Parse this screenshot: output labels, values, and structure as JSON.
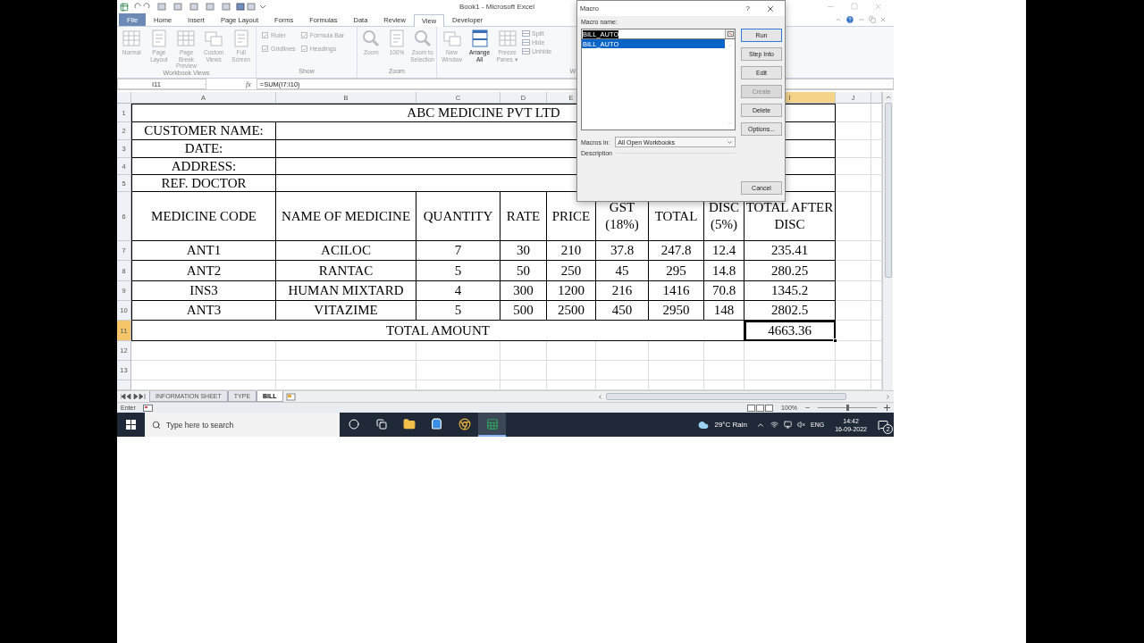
{
  "title_bar": {
    "title": "Book1 - Microsoft Excel"
  },
  "ribbon_tabs": [
    {
      "label": "File",
      "selected": false,
      "kind": "file"
    },
    {
      "label": "Home",
      "selected": false,
      "kind": "tab"
    },
    {
      "label": "Insert",
      "selected": false,
      "kind": "tab"
    },
    {
      "label": "Page Layout",
      "selected": false,
      "kind": "tab"
    },
    {
      "label": "Forms",
      "selected": false,
      "kind": "tab"
    },
    {
      "label": "Formulas",
      "selected": false,
      "kind": "tab"
    },
    {
      "label": "Data",
      "selected": false,
      "kind": "tab"
    },
    {
      "label": "Review",
      "selected": false,
      "kind": "tab"
    },
    {
      "label": "View",
      "selected": true,
      "kind": "tab"
    },
    {
      "label": "Developer",
      "selected": false,
      "kind": "tab"
    }
  ],
  "ribbon_groups": [
    {
      "label": "Workbook Views",
      "items": [
        {
          "kind": "button",
          "label": "Normal",
          "disabled": true
        },
        {
          "kind": "button",
          "label": "Page Layout",
          "disabled": true
        },
        {
          "kind": "button",
          "label": "Page Break Preview",
          "disabled": true
        },
        {
          "kind": "button",
          "label": "Custom Views",
          "disabled": true
        },
        {
          "kind": "button",
          "label": "Full Screen",
          "disabled": true
        }
      ]
    },
    {
      "label": "Show",
      "items": [
        {
          "kind": "checkbox",
          "label": "Ruler",
          "checked": true,
          "disabled": true
        },
        {
          "kind": "checkbox",
          "label": "Gridlines",
          "checked": true,
          "disabled": true
        },
        {
          "kind": "checkbox",
          "label": "Formula Bar",
          "checked": true,
          "disabled": true
        },
        {
          "kind": "checkbox",
          "label": "Headings",
          "checked": true,
          "disabled": true
        }
      ]
    },
    {
      "label": "Zoom",
      "items": [
        {
          "kind": "button",
          "label": "Zoom",
          "disabled": true
        },
        {
          "kind": "button",
          "label": "100%",
          "disabled": true
        },
        {
          "kind": "button",
          "label": "Zoom to Selection",
          "disabled": true
        }
      ]
    },
    {
      "label": "W",
      "items": [
        {
          "kind": "button",
          "label": "New Window",
          "disabled": true
        },
        {
          "kind": "button",
          "label": "Arrange All",
          "disabled": false
        },
        {
          "kind": "button",
          "label": "Freeze Panes ▾",
          "disabled": true
        },
        {
          "kind": "small",
          "label": "Split",
          "disabled": true
        },
        {
          "kind": "small",
          "label": "Hide",
          "disabled": true
        },
        {
          "kind": "small",
          "label": "Unhide",
          "disabled": true
        }
      ]
    }
  ],
  "formula_bar": {
    "name_box": "I11",
    "function_label": "fx",
    "formula": "=SUM(I7:I10)"
  },
  "sheet": {
    "columns": [
      {
        "label": "A",
        "selected": false
      },
      {
        "label": "B",
        "selected": false
      },
      {
        "label": "C",
        "selected": false
      },
      {
        "label": "D",
        "selected": false
      },
      {
        "label": "E",
        "selected": false
      },
      {
        "label": "I",
        "selected": true
      },
      {
        "label": "J",
        "selected": false
      }
    ],
    "rows": [
      {
        "number": "1",
        "selected": false
      },
      {
        "number": "2",
        "selected": false
      },
      {
        "number": "3",
        "selected": false
      },
      {
        "number": "4",
        "selected": false
      },
      {
        "number": "5",
        "selected": false
      },
      {
        "number": "6",
        "selected": false
      },
      {
        "number": "7",
        "selected": false
      },
      {
        "number": "8",
        "selected": false
      },
      {
        "number": "9",
        "selected": false
      },
      {
        "number": "10",
        "selected": false
      },
      {
        "number": "11",
        "selected": true
      },
      {
        "number": "12",
        "selected": false
      },
      {
        "number": "13",
        "selected": false
      }
    ],
    "title": "ABC MEDICINE PVT LTD",
    "info_labels": [
      "CUSTOMER NAME:",
      "DATE:",
      "ADDRESS:",
      "REF. DOCTOR"
    ],
    "headers": [
      "MEDICINE CODE",
      "NAME OF MEDICINE",
      "QUANTITY",
      "RATE",
      "PRICE",
      "GST (18%)",
      "TOTAL",
      "DISC (5%)",
      "TOTAL AFTER DISC"
    ],
    "data": [
      [
        "ANT1",
        "ACILOC",
        "7",
        "30",
        "210",
        "37.8",
        "247.8",
        "12.4",
        "235.41"
      ],
      [
        "ANT2",
        "RANTAC",
        "5",
        "50",
        "250",
        "45",
        "295",
        "14.8",
        "280.25"
      ],
      [
        "INS3",
        "HUMAN MIXTARD",
        "4",
        "300",
        "1200",
        "216",
        "1416",
        "70.8",
        "1345.2"
      ],
      [
        "ANT3",
        "VITAZIME",
        "5",
        "500",
        "2500",
        "450",
        "2950",
        "148",
        "2802.5"
      ]
    ],
    "total": {
      "label": "TOTAL AMOUNT",
      "value": "4663.36",
      "selected": true
    }
  },
  "sheet_tabs": [
    {
      "label": "INFORMATION SHEET",
      "selected": false
    },
    {
      "label": "TYPE",
      "selected": false
    },
    {
      "label": "BILL",
      "selected": true
    }
  ],
  "status_bar": {
    "mode": "Enter",
    "zoom": {
      "label": "100%",
      "level": 0.5
    }
  },
  "dialog": {
    "title": "Macro",
    "help": "?",
    "name_label": "Macro name:",
    "name_value": "BILL_AUTO",
    "value_selected": true,
    "macros": [
      {
        "label": "BILL_AUTO",
        "selected": true
      }
    ],
    "buttons": [
      {
        "label": "Run",
        "disabled": false,
        "focused": true
      },
      {
        "label": "Step Into",
        "disabled": false,
        "focused": false
      },
      {
        "label": "Edit",
        "disabled": false,
        "focused": false
      },
      {
        "label": "Create",
        "disabled": true,
        "focused": false
      },
      {
        "label": "Delete",
        "disabled": false,
        "focused": false
      },
      {
        "label": "Options...",
        "disabled": false,
        "focused": false
      }
    ],
    "cancel": "Cancel",
    "macros_in_label": "Macros in:",
    "macros_in_value": "All Open Workbooks",
    "description_label": "Description"
  },
  "taskbar": {
    "search_placeholder": "Type here to search",
    "apps": [
      {
        "kind": "cortana",
        "active": false
      },
      {
        "kind": "taskview",
        "active": false
      },
      {
        "kind": "folder",
        "active": false
      },
      {
        "kind": "store",
        "active": false
      },
      {
        "kind": "browser",
        "active": false
      },
      {
        "kind": "sheet",
        "active": true
      }
    ],
    "weather": "29°C Rain",
    "language": "ENG",
    "time": "14:42",
    "date": "16-09-2022",
    "notifications": "2"
  }
}
